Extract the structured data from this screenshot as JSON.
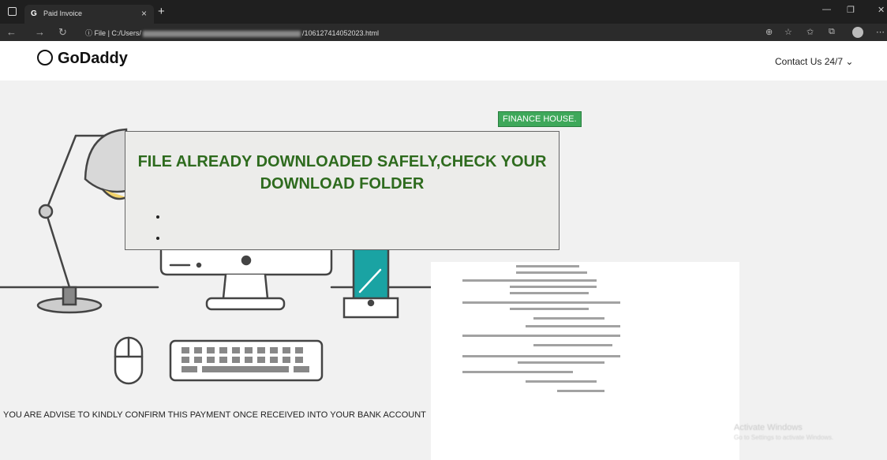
{
  "browser": {
    "tab_title": "Paid Invoice",
    "tab_favicon": "G",
    "address_prefix": "File",
    "url_start": "C:/Users/",
    "url_end": "/106127414052023.html"
  },
  "site": {
    "logo_text": "GoDaddy",
    "contact_label": "Contact Us 24/7 ⌄"
  },
  "main": {
    "badge": "FINANCE HOUSE.",
    "modal_message": "FILE ALREADY DOWNLOADED SAFELY,CHECK YOUR DOWNLOAD FOLDER",
    "notice": "YOU ARE ADVISE TO KINDLY CONFIRM THIS PAYMENT ONCE RECEIVED INTO YOUR BANK ACCOUNT"
  },
  "watermark": {
    "title": "Activate Windows",
    "subtitle": "Go to Settings to activate Windows."
  },
  "colors": {
    "accent_green": "#3ea85a",
    "message_green": "#2e6b1e"
  }
}
